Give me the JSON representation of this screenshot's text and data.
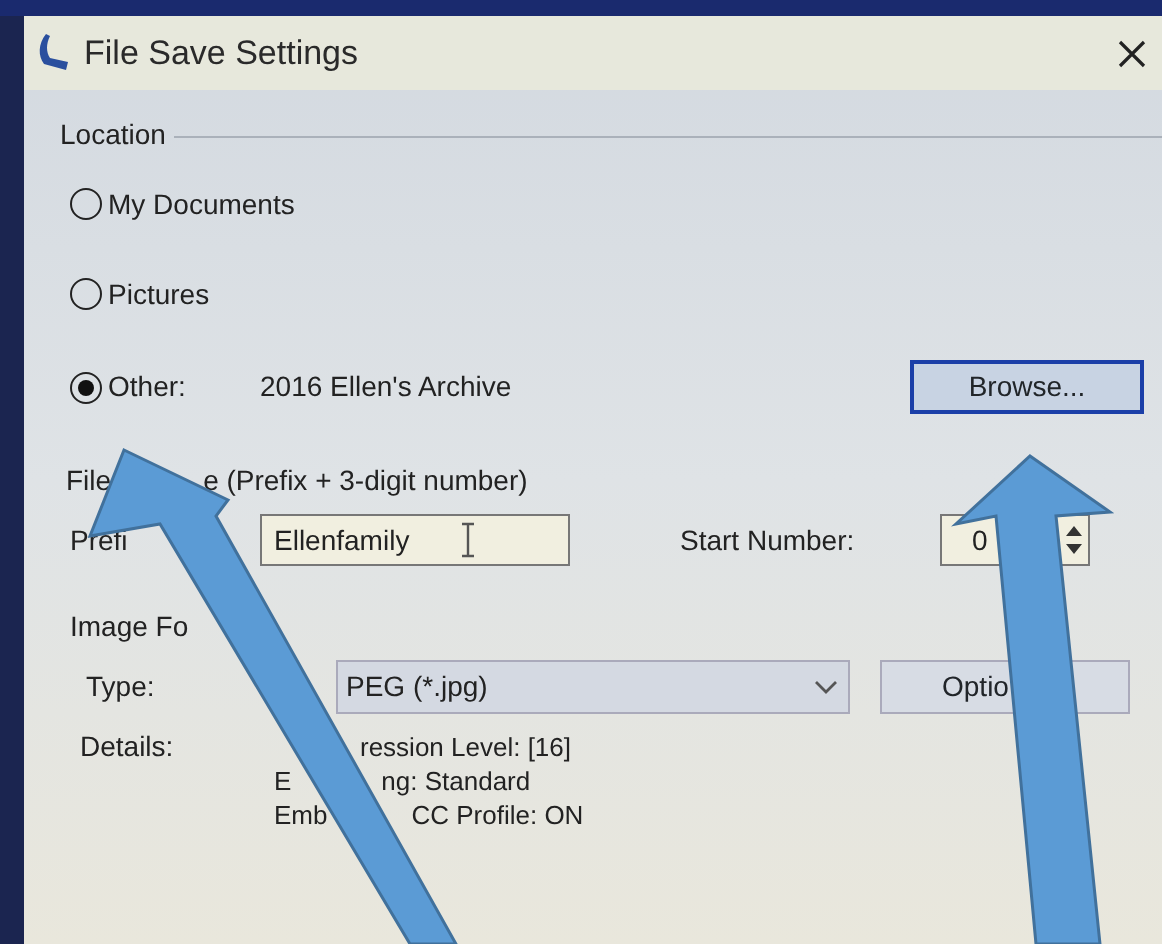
{
  "window": {
    "title": "File Save Settings"
  },
  "location": {
    "label": "Location",
    "options": [
      {
        "label": "My Documents",
        "selected": false
      },
      {
        "label": "Pictures",
        "selected": false
      },
      {
        "label": "Other:",
        "selected": true,
        "path": "2016 Ellen's Archive"
      }
    ],
    "browse": "Browse..."
  },
  "file_name": {
    "label_parts": [
      "File",
      "e (Prefix + 3-digit number)"
    ],
    "prefix_label": "Prefi",
    "prefix_value": "Ellenfamily",
    "start_number_label": "Start Number:",
    "start_number_value": "0"
  },
  "image_format": {
    "label": "Image Fo",
    "type_label": "Type:",
    "type_value": "PEG (*.jpg)",
    "options_button": "Optio",
    "details_label": "Details:",
    "details": [
      [
        "ression Level: [16]"
      ],
      [
        "E",
        "ng: Standard"
      ],
      [
        "Emb",
        "CC Profile: ON"
      ]
    ]
  }
}
